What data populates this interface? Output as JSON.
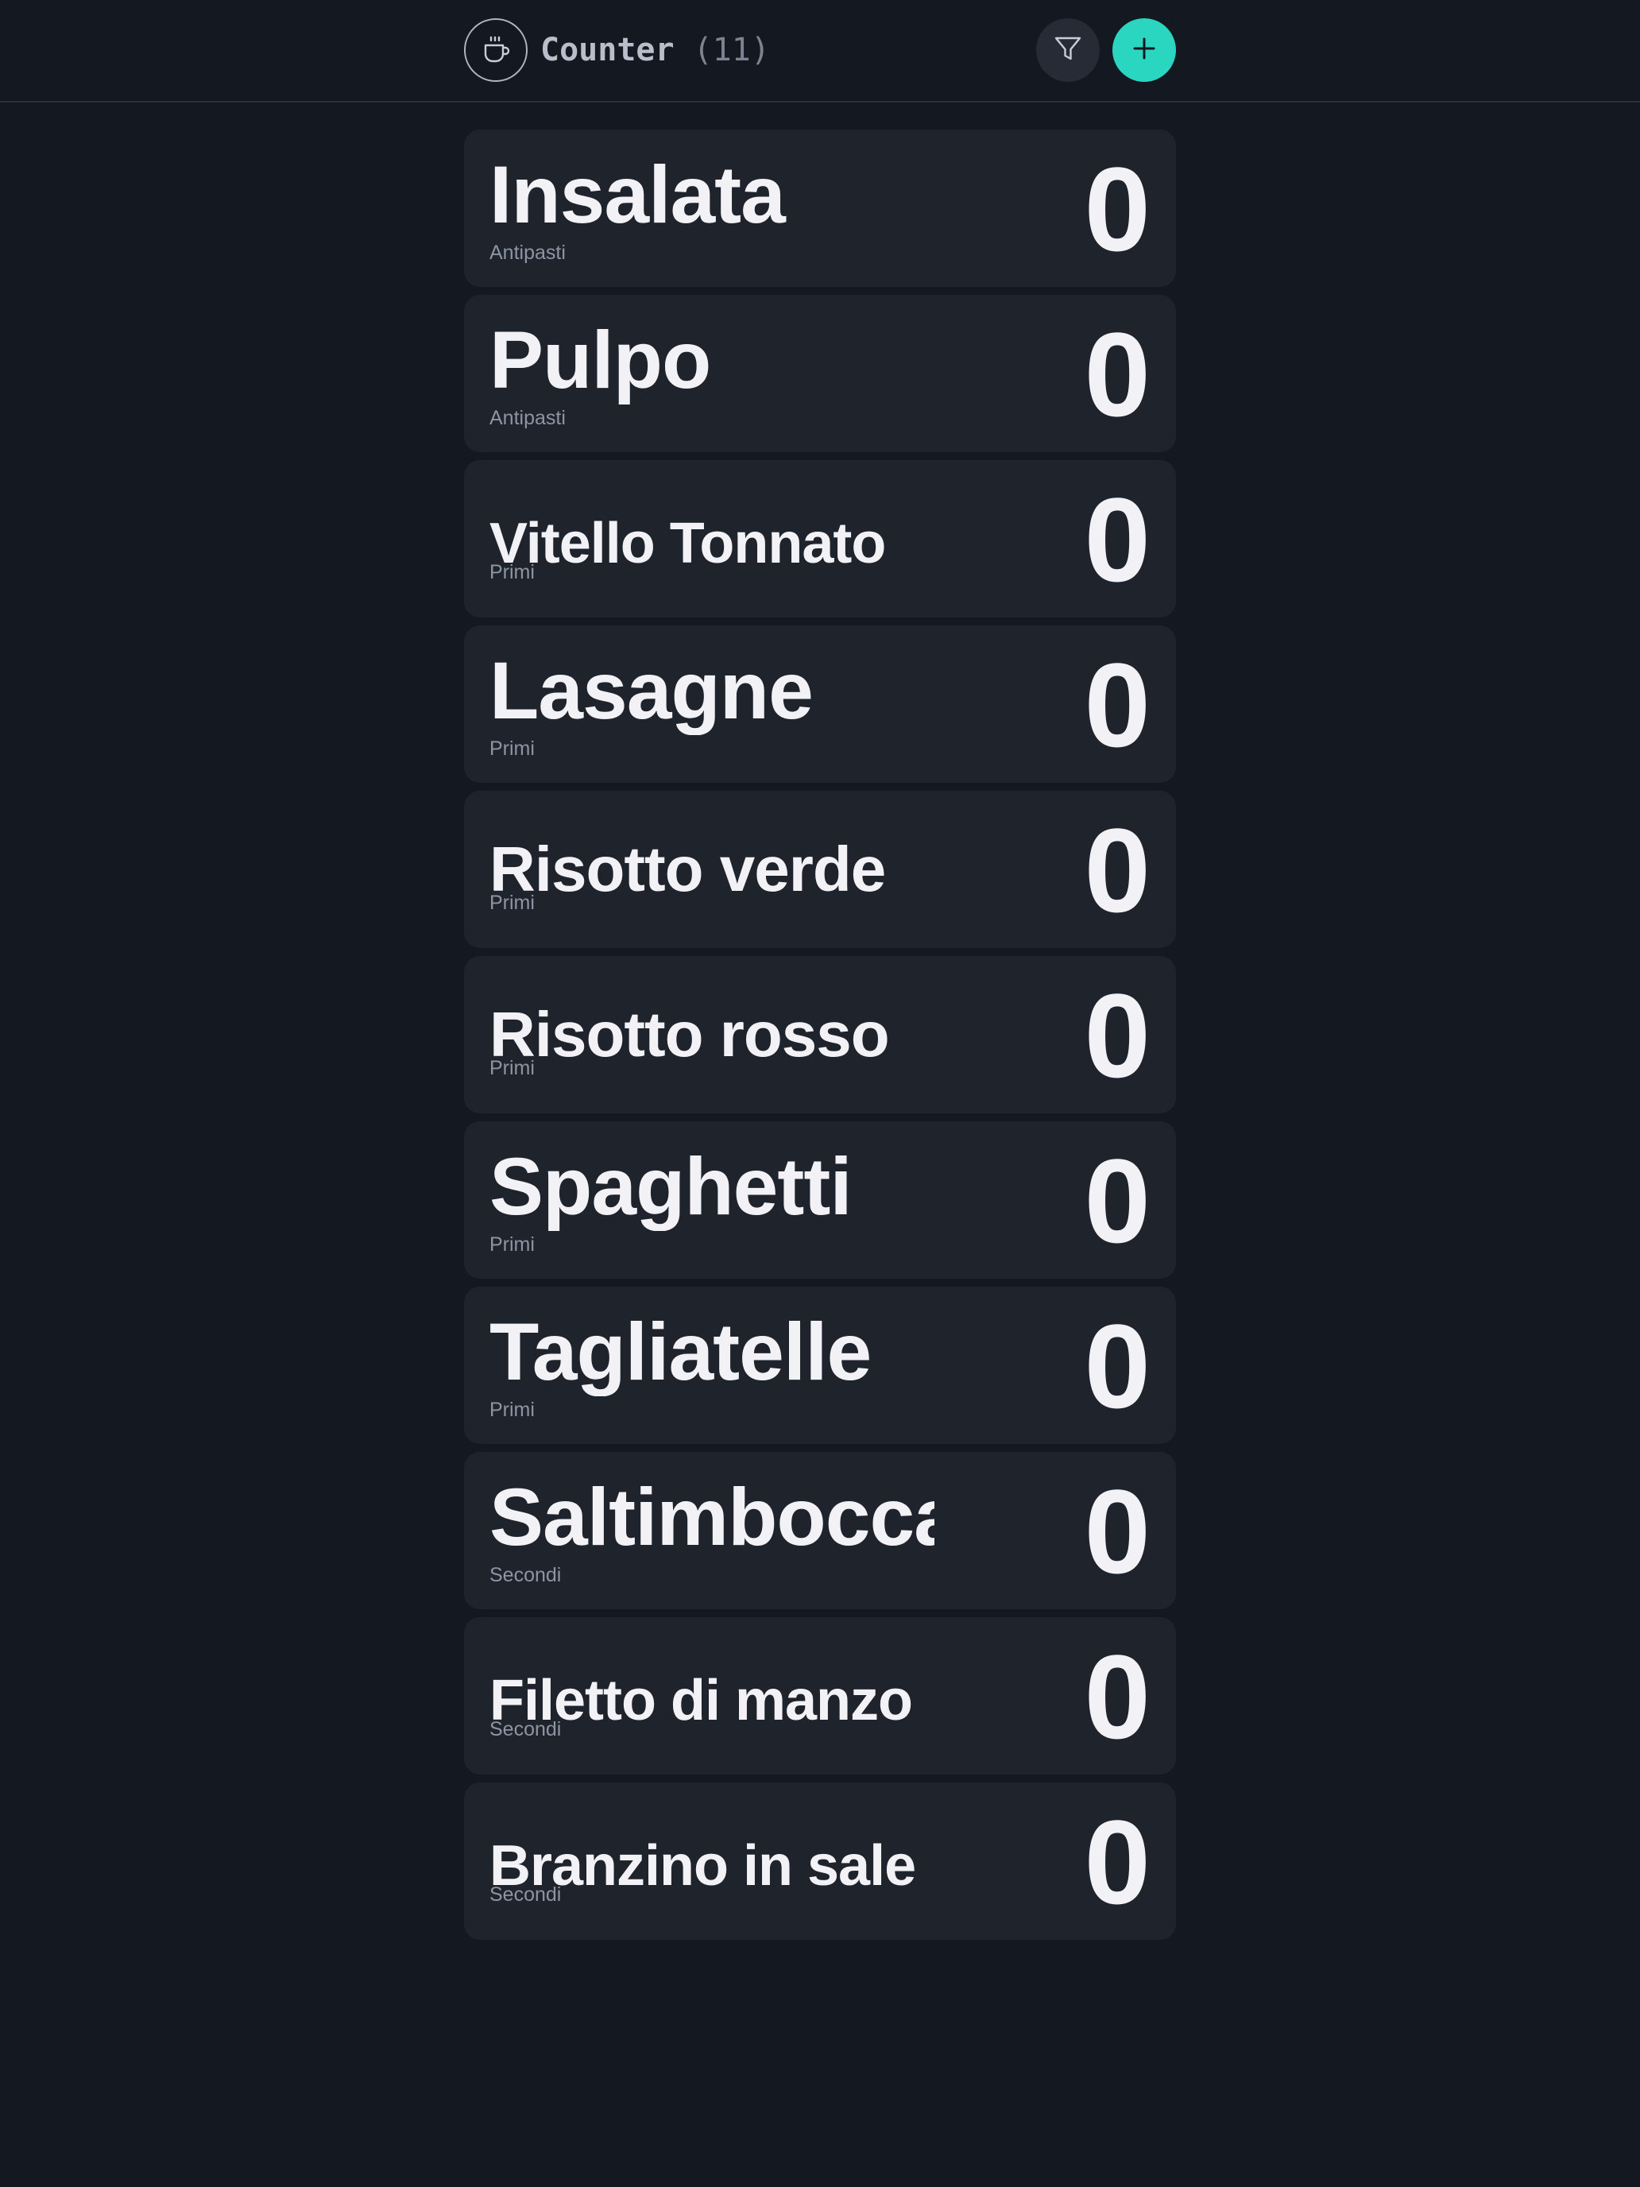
{
  "header": {
    "title": "Counter",
    "count": "(11)",
    "logo_icon": "coffee-cup-icon",
    "filter_icon": "filter-icon",
    "add_icon": "plus-icon"
  },
  "colors": {
    "background": "#141820",
    "card": "#1f232c",
    "accent": "#2ad6c0",
    "text": "#f2f2f6",
    "muted": "#8d95a3"
  },
  "items": [
    {
      "name": "Insalata",
      "category": "Antipasti",
      "count": "0"
    },
    {
      "name": "Pulpo",
      "category": "Antipasti",
      "count": "0"
    },
    {
      "name": "Vitello Tonnato",
      "category": "Primi",
      "count": "0"
    },
    {
      "name": "Lasagne",
      "category": "Primi",
      "count": "0"
    },
    {
      "name": "Risotto verde",
      "category": "Primi",
      "count": "0"
    },
    {
      "name": "Risotto rosso",
      "category": "Primi",
      "count": "0"
    },
    {
      "name": "Spaghetti",
      "category": "Primi",
      "count": "0"
    },
    {
      "name": "Tagliatelle",
      "category": "Primi",
      "count": "0"
    },
    {
      "name": "Saltimbocca",
      "category": "Secondi",
      "count": "0"
    },
    {
      "name": "Filetto di manzo",
      "category": "Secondi",
      "count": "0"
    },
    {
      "name": "Branzino in sale",
      "category": "Secondi",
      "count": "0"
    }
  ]
}
